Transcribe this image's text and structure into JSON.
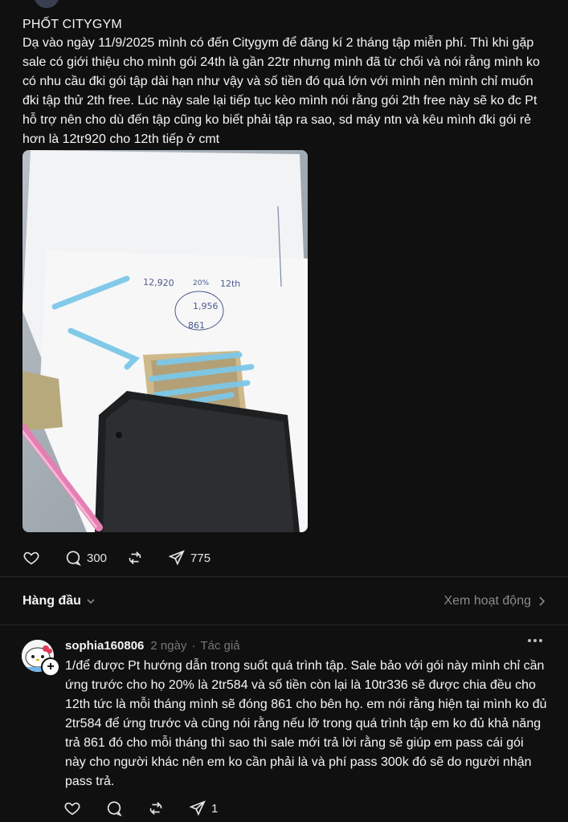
{
  "post": {
    "title": "PHỐT CITYGYM",
    "body": "Dạ vào ngày 11/9/2025 mình có đến Citygym để đăng kí 2 tháng tập miễn phí. Thì khi gặp sale có giới thiệu cho mình gói 24th là gần 22tr nhưng mình đã từ chối và nói rằng mình ko có nhu cầu đki gói tập dài hạn như vậy và số tiền đó quá lớn với mình nên mình chỉ muốn đki tập thử 2th free. Lúc này sale lại tiếp tục kèo mình nói rằng gói 2th free này sẽ ko đc Pt hỗ trợ nên cho dù đến tập cũng ko biết phải tập ra sao, sd máy ntn và kêu mình đki gói rẻ hơn là 12tr920 cho 12th tiếp ở cmt",
    "photo_handwriting": [
      "12,920",
      "1,956",
      "861",
      "12th",
      "20%"
    ],
    "actions": {
      "likes": "",
      "comments": "300",
      "reposts": "",
      "shares": "775"
    }
  },
  "sort": {
    "label": "Hàng đầu",
    "activity_link": "Xem hoạt động"
  },
  "comment": {
    "username": "sophia160806",
    "time": "2 ngày",
    "separator": "·",
    "role": "Tác giả",
    "body": "1/để được Pt hướng dẫn trong suốt quá trình tập. Sale bảo với gói này mình chỉ cần ứng trước cho họ 20% là 2tr584 và số tiền còn lại là 10tr336 sẽ được chia đều cho 12th tức là mỗi tháng mình sẽ đóng 861 cho bên họ. em nói rằng hiện tại mình ko đủ 2tr584 để ứng trước và cũng nói rằng nếu lỡ trong quá trình tập em ko đủ khả năng trả 861 đó cho mỗi tháng thì sao thì sale mới trả lời rằng sẽ giúp em pass cái gói này cho người khác nên em ko cần phải là và phí pass 300k đó sẽ do người nhận pass trả.",
    "actions": {
      "likes": "",
      "comments": "",
      "reposts": "",
      "shares": "1"
    },
    "add_symbol": "+"
  },
  "colors": {
    "background": "#101010",
    "text": "#f3f5f7",
    "muted": "#777777",
    "divider": "#2a2a2a"
  },
  "icons": [
    "heart-icon",
    "comment-icon",
    "repost-icon",
    "share-icon",
    "chevron-down-icon",
    "chevron-right-icon",
    "more-icon",
    "plus-icon"
  ]
}
